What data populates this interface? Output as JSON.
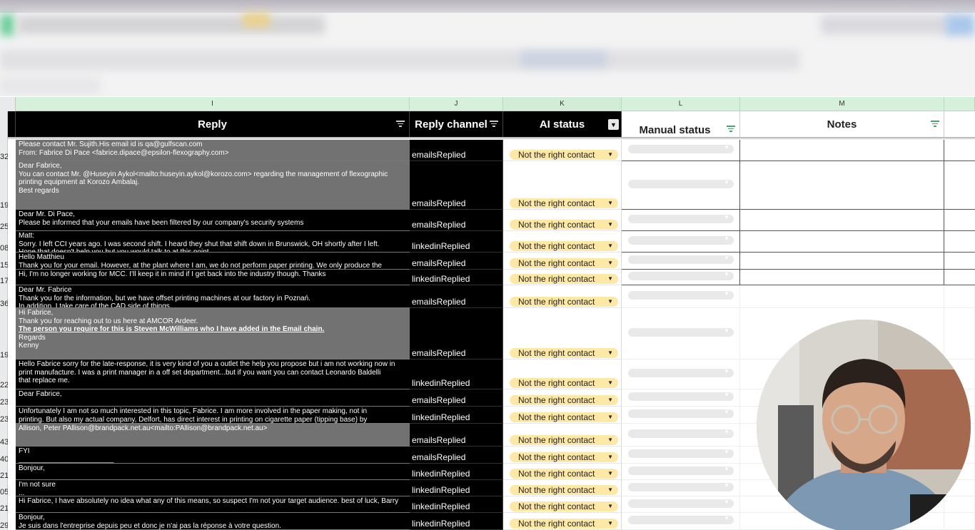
{
  "columns": [
    {
      "letter": "I",
      "header": "Reply"
    },
    {
      "letter": "J",
      "header": "Reply channel"
    },
    {
      "letter": "K",
      "header": "AI status"
    },
    {
      "letter": "L",
      "header": "Manual status"
    },
    {
      "letter": "M",
      "header": "Notes"
    }
  ],
  "rows": [
    {
      "num": "32",
      "channel": "emailsReplied",
      "ai_status": "Not the right contact",
      "shade": "gray",
      "lines": [
        "Please contact Mr. Sujith.His email id is qa@gulfscan.com",
        "",
        "From: Fabrice Di Pace <fabrice.dipace@epsilon-flexography.com>"
      ]
    },
    {
      "num": "19",
      "channel": "emailsReplied",
      "ai_status": "Not the right contact",
      "shade": "gray",
      "lines": [
        "Dear Fabrice,",
        "",
        "You can contact Mr. @Huseyin Aykol<mailto:huseyin.aykol@korozo.com> regarding the management of flexographic",
        "printing equipment at Korozo Ambalaj.",
        "",
        "Best regards"
      ]
    },
    {
      "num": "25",
      "channel": "emailsReplied",
      "ai_status": "Not the right contact",
      "shade": "black",
      "lines": [
        "Dear Mr. Di Pace,",
        "",
        "Please be informed that your emails have been filtered by our company's security systems"
      ]
    },
    {
      "num": "08",
      "channel": "linkedinReplied",
      "ai_status": "Not the right contact",
      "shade": "black",
      "lines": [
        "Matt:",
        "Sorry.  I left CCI years ago.  I was second shift.  I heard they shut that shift down in Brunswick, OH shortly after I left.",
        "Hope that doesn't help you but you would talk to at this point"
      ]
    },
    {
      "num": "15",
      "channel": "emailsReplied",
      "ai_status": "Not the right contact",
      "shade": "black",
      "lines": [
        "Hello Matthieu",
        "Thank you for your email. However, at the plant where I am, we do not perform paper printing. We only produce the"
      ]
    },
    {
      "num": "17",
      "channel": "linkedinReplied",
      "ai_status": "Not the right contact",
      "shade": "black",
      "lines": [
        "",
        "Hi, I'm no longer working for MCC. I'll keep it in mind if I get back into the industry though. Thanks"
      ]
    },
    {
      "num": "36",
      "channel": "emailsReplied",
      "ai_status": "Not the right contact",
      "shade": "black",
      "lines": [
        "Dear Mr. Fabrice",
        "Thank you for the information, but we have offset printing machines at our factory in Poznań.",
        "In addition, I take care of the CAD side of things."
      ]
    },
    {
      "num": "19",
      "channel": "emailsReplied",
      "ai_status": "Not the right contact",
      "shade": "gray",
      "lines": [
        "Hi Fabrice,",
        "Thank you for reaching out to us here at AMCOR Ardeer.",
        "The person you require for this is Steven McWilliams who I have added in the Email chain.",
        "",
        "Regards",
        "Kenny"
      ]
    },
    {
      "num": "22",
      "channel": "linkedinReplied",
      "ai_status": "Not the right contact",
      "shade": "black",
      "lines": [
        "Hello Fabrice sorry for the late-response, it is very kind of you a outlet the help you propose but i am not working now in",
        "print manufacture. I was a print manager in a off set department...but if you want you can contact Leonardo Baldelli",
        "that replace me."
      ]
    },
    {
      "num": "23",
      "channel": "emailsReplied",
      "ai_status": "Not the right contact",
      "shade": "black",
      "lines": [
        "Dear Fabrice,"
      ]
    },
    {
      "num": "23",
      "channel": "linkedinReplied",
      "ai_status": "Not the right contact",
      "shade": "black",
      "lines": [
        "Unfortunately I am not so much interested in this topic, Fabrice. I am more involved in the paper making, not in",
        "printing. But also my actual company, Delfort, has direct interest in printing on cigarette paper (tipping base) by"
      ]
    },
    {
      "num": "43",
      "channel": "emailsReplied",
      "ai_status": "Not the right contact",
      "shade": "gray",
      "lines": [
        "",
        "Allison, Peter PAllison@brandpack.net.au<mailto:PAllison@brandpack.net.au>"
      ]
    },
    {
      "num": "40",
      "channel": "emailsReplied",
      "ai_status": "Not the right contact",
      "shade": "black",
      "lines": [
        "FYI",
        "________________________"
      ]
    },
    {
      "num": "21",
      "channel": "linkedinReplied",
      "ai_status": "Not the right contact",
      "shade": "black",
      "lines": [
        "Bonjour,"
      ]
    },
    {
      "num": "05",
      "channel": "linkedinReplied",
      "ai_status": "Not the right contact",
      "shade": "black",
      "lines": [
        "I'm not sure",
        "..."
      ]
    },
    {
      "num": "21",
      "channel": "linkedinReplied",
      "ai_status": "Not the right contact",
      "shade": "black",
      "lines": [
        "",
        "Hi Fabrice, I have absolutely no idea what any of this means, so suspect I'm not your target audience.  best of luck, Barry"
      ]
    },
    {
      "num": "29",
      "channel": "linkedinReplied",
      "ai_status": "Not the right contact",
      "shade": "black",
      "lines": [
        "Bonjour,",
        "Je suis dans l'entreprise depuis peu et donc je n'ai pas la réponse à votre question."
      ]
    }
  ],
  "icons": {
    "filter": "filter-icon",
    "filter_active": "filter-active-icon",
    "dropdown": "chevron-down-icon"
  },
  "colors": {
    "ai_chip": "#fde8a6",
    "header_dark": "#000000",
    "column_header": "#d6f0dc",
    "reply_gray": "#727272"
  }
}
